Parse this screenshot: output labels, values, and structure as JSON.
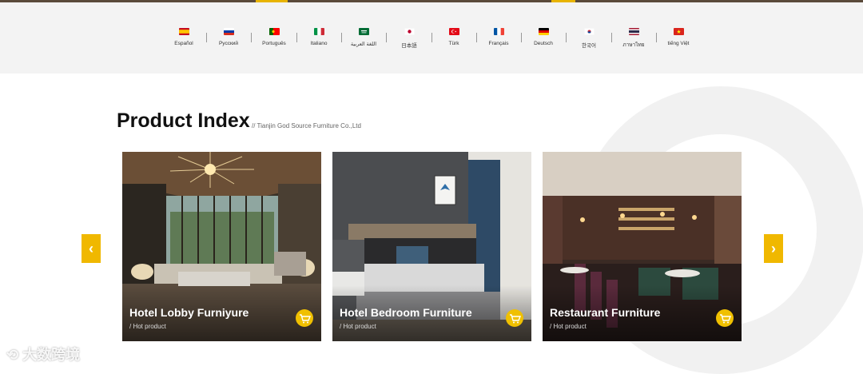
{
  "languages": [
    {
      "label": "Español",
      "flag": "es"
    },
    {
      "label": "Русский",
      "flag": "ru"
    },
    {
      "label": "Português",
      "flag": "pt"
    },
    {
      "label": "Italiano",
      "flag": "it"
    },
    {
      "label": "اللغة العربية",
      "flag": "sa"
    },
    {
      "label": "日本語",
      "flag": "jp"
    },
    {
      "label": "Türk",
      "flag": "tr"
    },
    {
      "label": "Français",
      "flag": "fr"
    },
    {
      "label": "Deutsch",
      "flag": "de"
    },
    {
      "label": "한국어",
      "flag": "kr"
    },
    {
      "label": "ภาษาไทย",
      "flag": "th"
    },
    {
      "label": "tiếng Việt",
      "flag": "vn"
    }
  ],
  "section": {
    "title": "Product Index",
    "subtitle": "// Tianjin God Source Furniture Co.,Ltd"
  },
  "products": [
    {
      "title": "Hotel Lobby Furniyure",
      "tag": "/ Hot product"
    },
    {
      "title": "Hotel Bedroom Furniture",
      "tag": "/ Hot product"
    },
    {
      "title": "Restaurant Furniture",
      "tag": "/ Hot product"
    }
  ],
  "carousel": {
    "prev_icon": "chevron-left-icon",
    "next_icon": "chevron-right-icon",
    "prev_glyph": "‹",
    "next_glyph": "›"
  },
  "watermark": "大数跨境",
  "colors": {
    "accent": "#f0b800",
    "band": "#f3f3f3"
  }
}
